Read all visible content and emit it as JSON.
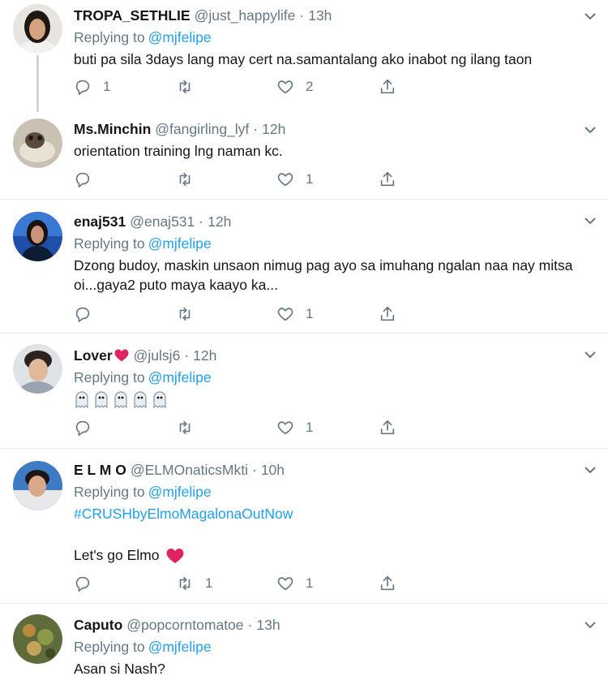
{
  "tweets": [
    {
      "display_name": "TROPA_SETHLIE",
      "handle": "@just_happylife",
      "time": "13h",
      "replying_prefix": "Replying to",
      "replying_to": "@mjfelipe",
      "text": "buti pa sila 3days lang may cert na.samantalang ako inabot ng ilang taon",
      "counts": {
        "reply": "1",
        "retweet": "",
        "like": "2"
      }
    },
    {
      "display_name": "Ms.Minchin",
      "handle": "@fangirling_lyf",
      "time": "12h",
      "text": "orientation training lng naman kc.",
      "counts": {
        "reply": "",
        "retweet": "",
        "like": "1"
      }
    },
    {
      "display_name": "enaj531",
      "handle": "@enaj531",
      "time": "12h",
      "replying_prefix": "Replying to",
      "replying_to": "@mjfelipe",
      "text": "Dzong budoy, maskin unsaon nimug pag ayo sa imuhang ngalan naa nay mitsa oi...gaya2 puto maya kaayo ka...",
      "counts": {
        "reply": "",
        "retweet": "",
        "like": "1"
      }
    },
    {
      "display_name": "Lover",
      "handle": "@julsj6",
      "time": "12h",
      "replying_prefix": "Replying to",
      "replying_to": "@mjfelipe",
      "emoji": "ghost-emoji x5",
      "counts": {
        "reply": "",
        "retweet": "",
        "like": "1"
      }
    },
    {
      "display_name": "E L M O",
      "handle": "@ELMOnaticsMkti",
      "time": "10h",
      "replying_prefix": "Replying to",
      "replying_to": "@mjfelipe",
      "hashtag": "#CRUSHbyElmoMagalonaOutNow",
      "text": "Let's go Elmo",
      "counts": {
        "reply": "",
        "retweet": "1",
        "like": "1"
      }
    },
    {
      "display_name": "Caputo",
      "handle": "@popcorntomatoe",
      "time": "13h",
      "replying_prefix": "Replying to",
      "replying_to": "@mjfelipe",
      "text": "Asan si Nash?"
    }
  ],
  "separator": "·",
  "colors": {
    "link": "#1da1f2",
    "secondary_text": "#657786",
    "heart": "#e0245e",
    "divider": "#e6ecf0"
  },
  "icons": {
    "reply": "reply-icon",
    "retweet": "retweet-icon",
    "like": "like-icon",
    "share": "share-icon",
    "more": "chevron-down-icon"
  }
}
